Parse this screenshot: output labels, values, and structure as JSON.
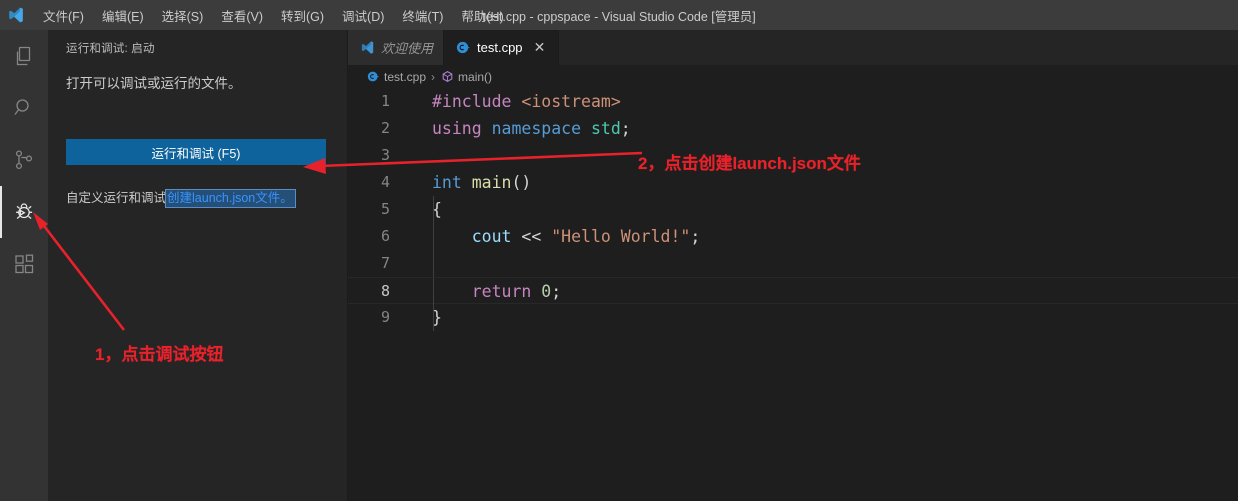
{
  "window": {
    "title": "test.cpp - cppspace - Visual Studio Code [管理员]",
    "logo_icon": "vscode-logo-icon"
  },
  "menubar": {
    "items": [
      {
        "label": "文件(F)",
        "name": "menu-file"
      },
      {
        "label": "编辑(E)",
        "name": "menu-edit"
      },
      {
        "label": "选择(S)",
        "name": "menu-selection"
      },
      {
        "label": "查看(V)",
        "name": "menu-view"
      },
      {
        "label": "转到(G)",
        "name": "menu-go"
      },
      {
        "label": "调试(D)",
        "name": "menu-debug"
      },
      {
        "label": "终端(T)",
        "name": "menu-terminal"
      },
      {
        "label": "帮助(H)",
        "name": "menu-help"
      }
    ]
  },
  "activitybar": {
    "items": [
      {
        "icon": "files-explorer-icon",
        "active": false
      },
      {
        "icon": "search-icon",
        "active": false
      },
      {
        "icon": "source-control-icon",
        "active": false
      },
      {
        "icon": "run-and-debug-icon",
        "active": true
      },
      {
        "icon": "extensions-icon",
        "active": false
      }
    ]
  },
  "sidebar": {
    "header": "运行和调试: 启动",
    "description": "打开可以调试或运行的文件。",
    "run_button_label": "运行和调试 (F5)",
    "customize_prefix": "自定义运行和调试",
    "customize_link": "创建launch.json文件。"
  },
  "tabs": [
    {
      "label": "欢迎使用",
      "icon": "vscode-logo-icon",
      "active": false,
      "closable": false
    },
    {
      "label": "test.cpp",
      "icon": "cpp-file-icon",
      "active": true,
      "closable": true,
      "close_glyph": "✕"
    }
  ],
  "breadcrumb": {
    "separator": "›",
    "segments": [
      {
        "label": "test.cpp",
        "icon": "cpp-file-icon"
      },
      {
        "label": "main()",
        "icon": "method-symbol-icon"
      }
    ]
  },
  "code": {
    "lines": [
      {
        "number": "1",
        "current": false,
        "tokens": [
          {
            "t": "#include",
            "c": "kw"
          },
          {
            "t": " ",
            "c": "pun"
          },
          {
            "t": "<iostream>",
            "c": "str"
          }
        ]
      },
      {
        "number": "2",
        "current": false,
        "tokens": [
          {
            "t": "using",
            "c": "kw"
          },
          {
            "t": " ",
            "c": "pun"
          },
          {
            "t": "namespace",
            "c": "blue"
          },
          {
            "t": " ",
            "c": "pun"
          },
          {
            "t": "std",
            "c": "teal"
          },
          {
            "t": ";",
            "c": "pun"
          }
        ]
      },
      {
        "number": "3",
        "current": false,
        "tokens": []
      },
      {
        "number": "4",
        "current": false,
        "tokens": [
          {
            "t": "int",
            "c": "blue"
          },
          {
            "t": " ",
            "c": "pun"
          },
          {
            "t": "main",
            "c": "fn"
          },
          {
            "t": "()",
            "c": "pun"
          }
        ]
      },
      {
        "number": "5",
        "current": false,
        "tokens": [
          {
            "t": "{",
            "c": "pun"
          }
        ]
      },
      {
        "number": "6",
        "current": false,
        "tokens": [
          {
            "t": "    ",
            "c": "pun"
          },
          {
            "t": "cout",
            "c": "var"
          },
          {
            "t": " << ",
            "c": "pun"
          },
          {
            "t": "\"Hello World!\"",
            "c": "str"
          },
          {
            "t": ";",
            "c": "pun"
          }
        ]
      },
      {
        "number": "7",
        "current": false,
        "tokens": []
      },
      {
        "number": "8",
        "current": true,
        "tokens": [
          {
            "t": "    ",
            "c": "pun"
          },
          {
            "t": "return",
            "c": "kw"
          },
          {
            "t": " ",
            "c": "pun"
          },
          {
            "t": "0",
            "c": "num"
          },
          {
            "t": ";",
            "c": "pun"
          }
        ]
      },
      {
        "number": "9",
        "current": false,
        "tokens": [
          {
            "t": "}",
            "c": "pun"
          }
        ]
      }
    ]
  },
  "annotations": {
    "color": "#e8222a",
    "step1": "1，点击调试按钮",
    "step2": "2，点击创建launch.json文件"
  }
}
